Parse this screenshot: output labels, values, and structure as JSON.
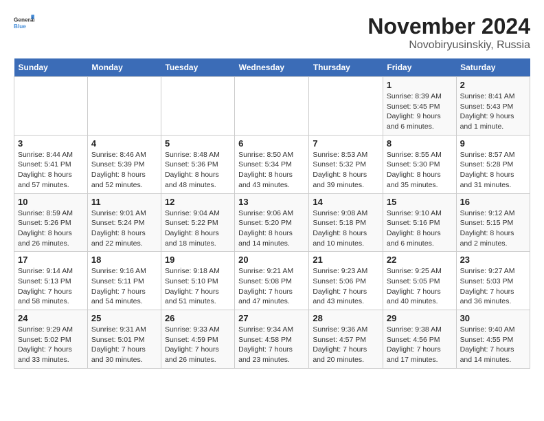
{
  "header": {
    "logo_line1": "General",
    "logo_line2": "Blue",
    "title": "November 2024",
    "subtitle": "Novobiryusinskiy, Russia"
  },
  "columns": [
    "Sunday",
    "Monday",
    "Tuesday",
    "Wednesday",
    "Thursday",
    "Friday",
    "Saturday"
  ],
  "weeks": [
    [
      {
        "day": "",
        "detail": ""
      },
      {
        "day": "",
        "detail": ""
      },
      {
        "day": "",
        "detail": ""
      },
      {
        "day": "",
        "detail": ""
      },
      {
        "day": "",
        "detail": ""
      },
      {
        "day": "1",
        "detail": "Sunrise: 8:39 AM\nSunset: 5:45 PM\nDaylight: 9 hours and 6 minutes."
      },
      {
        "day": "2",
        "detail": "Sunrise: 8:41 AM\nSunset: 5:43 PM\nDaylight: 9 hours and 1 minute."
      }
    ],
    [
      {
        "day": "3",
        "detail": "Sunrise: 8:44 AM\nSunset: 5:41 PM\nDaylight: 8 hours and 57 minutes."
      },
      {
        "day": "4",
        "detail": "Sunrise: 8:46 AM\nSunset: 5:39 PM\nDaylight: 8 hours and 52 minutes."
      },
      {
        "day": "5",
        "detail": "Sunrise: 8:48 AM\nSunset: 5:36 PM\nDaylight: 8 hours and 48 minutes."
      },
      {
        "day": "6",
        "detail": "Sunrise: 8:50 AM\nSunset: 5:34 PM\nDaylight: 8 hours and 43 minutes."
      },
      {
        "day": "7",
        "detail": "Sunrise: 8:53 AM\nSunset: 5:32 PM\nDaylight: 8 hours and 39 minutes."
      },
      {
        "day": "8",
        "detail": "Sunrise: 8:55 AM\nSunset: 5:30 PM\nDaylight: 8 hours and 35 minutes."
      },
      {
        "day": "9",
        "detail": "Sunrise: 8:57 AM\nSunset: 5:28 PM\nDaylight: 8 hours and 31 minutes."
      }
    ],
    [
      {
        "day": "10",
        "detail": "Sunrise: 8:59 AM\nSunset: 5:26 PM\nDaylight: 8 hours and 26 minutes."
      },
      {
        "day": "11",
        "detail": "Sunrise: 9:01 AM\nSunset: 5:24 PM\nDaylight: 8 hours and 22 minutes."
      },
      {
        "day": "12",
        "detail": "Sunrise: 9:04 AM\nSunset: 5:22 PM\nDaylight: 8 hours and 18 minutes."
      },
      {
        "day": "13",
        "detail": "Sunrise: 9:06 AM\nSunset: 5:20 PM\nDaylight: 8 hours and 14 minutes."
      },
      {
        "day": "14",
        "detail": "Sunrise: 9:08 AM\nSunset: 5:18 PM\nDaylight: 8 hours and 10 minutes."
      },
      {
        "day": "15",
        "detail": "Sunrise: 9:10 AM\nSunset: 5:16 PM\nDaylight: 8 hours and 6 minutes."
      },
      {
        "day": "16",
        "detail": "Sunrise: 9:12 AM\nSunset: 5:15 PM\nDaylight: 8 hours and 2 minutes."
      }
    ],
    [
      {
        "day": "17",
        "detail": "Sunrise: 9:14 AM\nSunset: 5:13 PM\nDaylight: 7 hours and 58 minutes."
      },
      {
        "day": "18",
        "detail": "Sunrise: 9:16 AM\nSunset: 5:11 PM\nDaylight: 7 hours and 54 minutes."
      },
      {
        "day": "19",
        "detail": "Sunrise: 9:18 AM\nSunset: 5:10 PM\nDaylight: 7 hours and 51 minutes."
      },
      {
        "day": "20",
        "detail": "Sunrise: 9:21 AM\nSunset: 5:08 PM\nDaylight: 7 hours and 47 minutes."
      },
      {
        "day": "21",
        "detail": "Sunrise: 9:23 AM\nSunset: 5:06 PM\nDaylight: 7 hours and 43 minutes."
      },
      {
        "day": "22",
        "detail": "Sunrise: 9:25 AM\nSunset: 5:05 PM\nDaylight: 7 hours and 40 minutes."
      },
      {
        "day": "23",
        "detail": "Sunrise: 9:27 AM\nSunset: 5:03 PM\nDaylight: 7 hours and 36 minutes."
      }
    ],
    [
      {
        "day": "24",
        "detail": "Sunrise: 9:29 AM\nSunset: 5:02 PM\nDaylight: 7 hours and 33 minutes."
      },
      {
        "day": "25",
        "detail": "Sunrise: 9:31 AM\nSunset: 5:01 PM\nDaylight: 7 hours and 30 minutes."
      },
      {
        "day": "26",
        "detail": "Sunrise: 9:33 AM\nSunset: 4:59 PM\nDaylight: 7 hours and 26 minutes."
      },
      {
        "day": "27",
        "detail": "Sunrise: 9:34 AM\nSunset: 4:58 PM\nDaylight: 7 hours and 23 minutes."
      },
      {
        "day": "28",
        "detail": "Sunrise: 9:36 AM\nSunset: 4:57 PM\nDaylight: 7 hours and 20 minutes."
      },
      {
        "day": "29",
        "detail": "Sunrise: 9:38 AM\nSunset: 4:56 PM\nDaylight: 7 hours and 17 minutes."
      },
      {
        "day": "30",
        "detail": "Sunrise: 9:40 AM\nSunset: 4:55 PM\nDaylight: 7 hours and 14 minutes."
      }
    ]
  ]
}
